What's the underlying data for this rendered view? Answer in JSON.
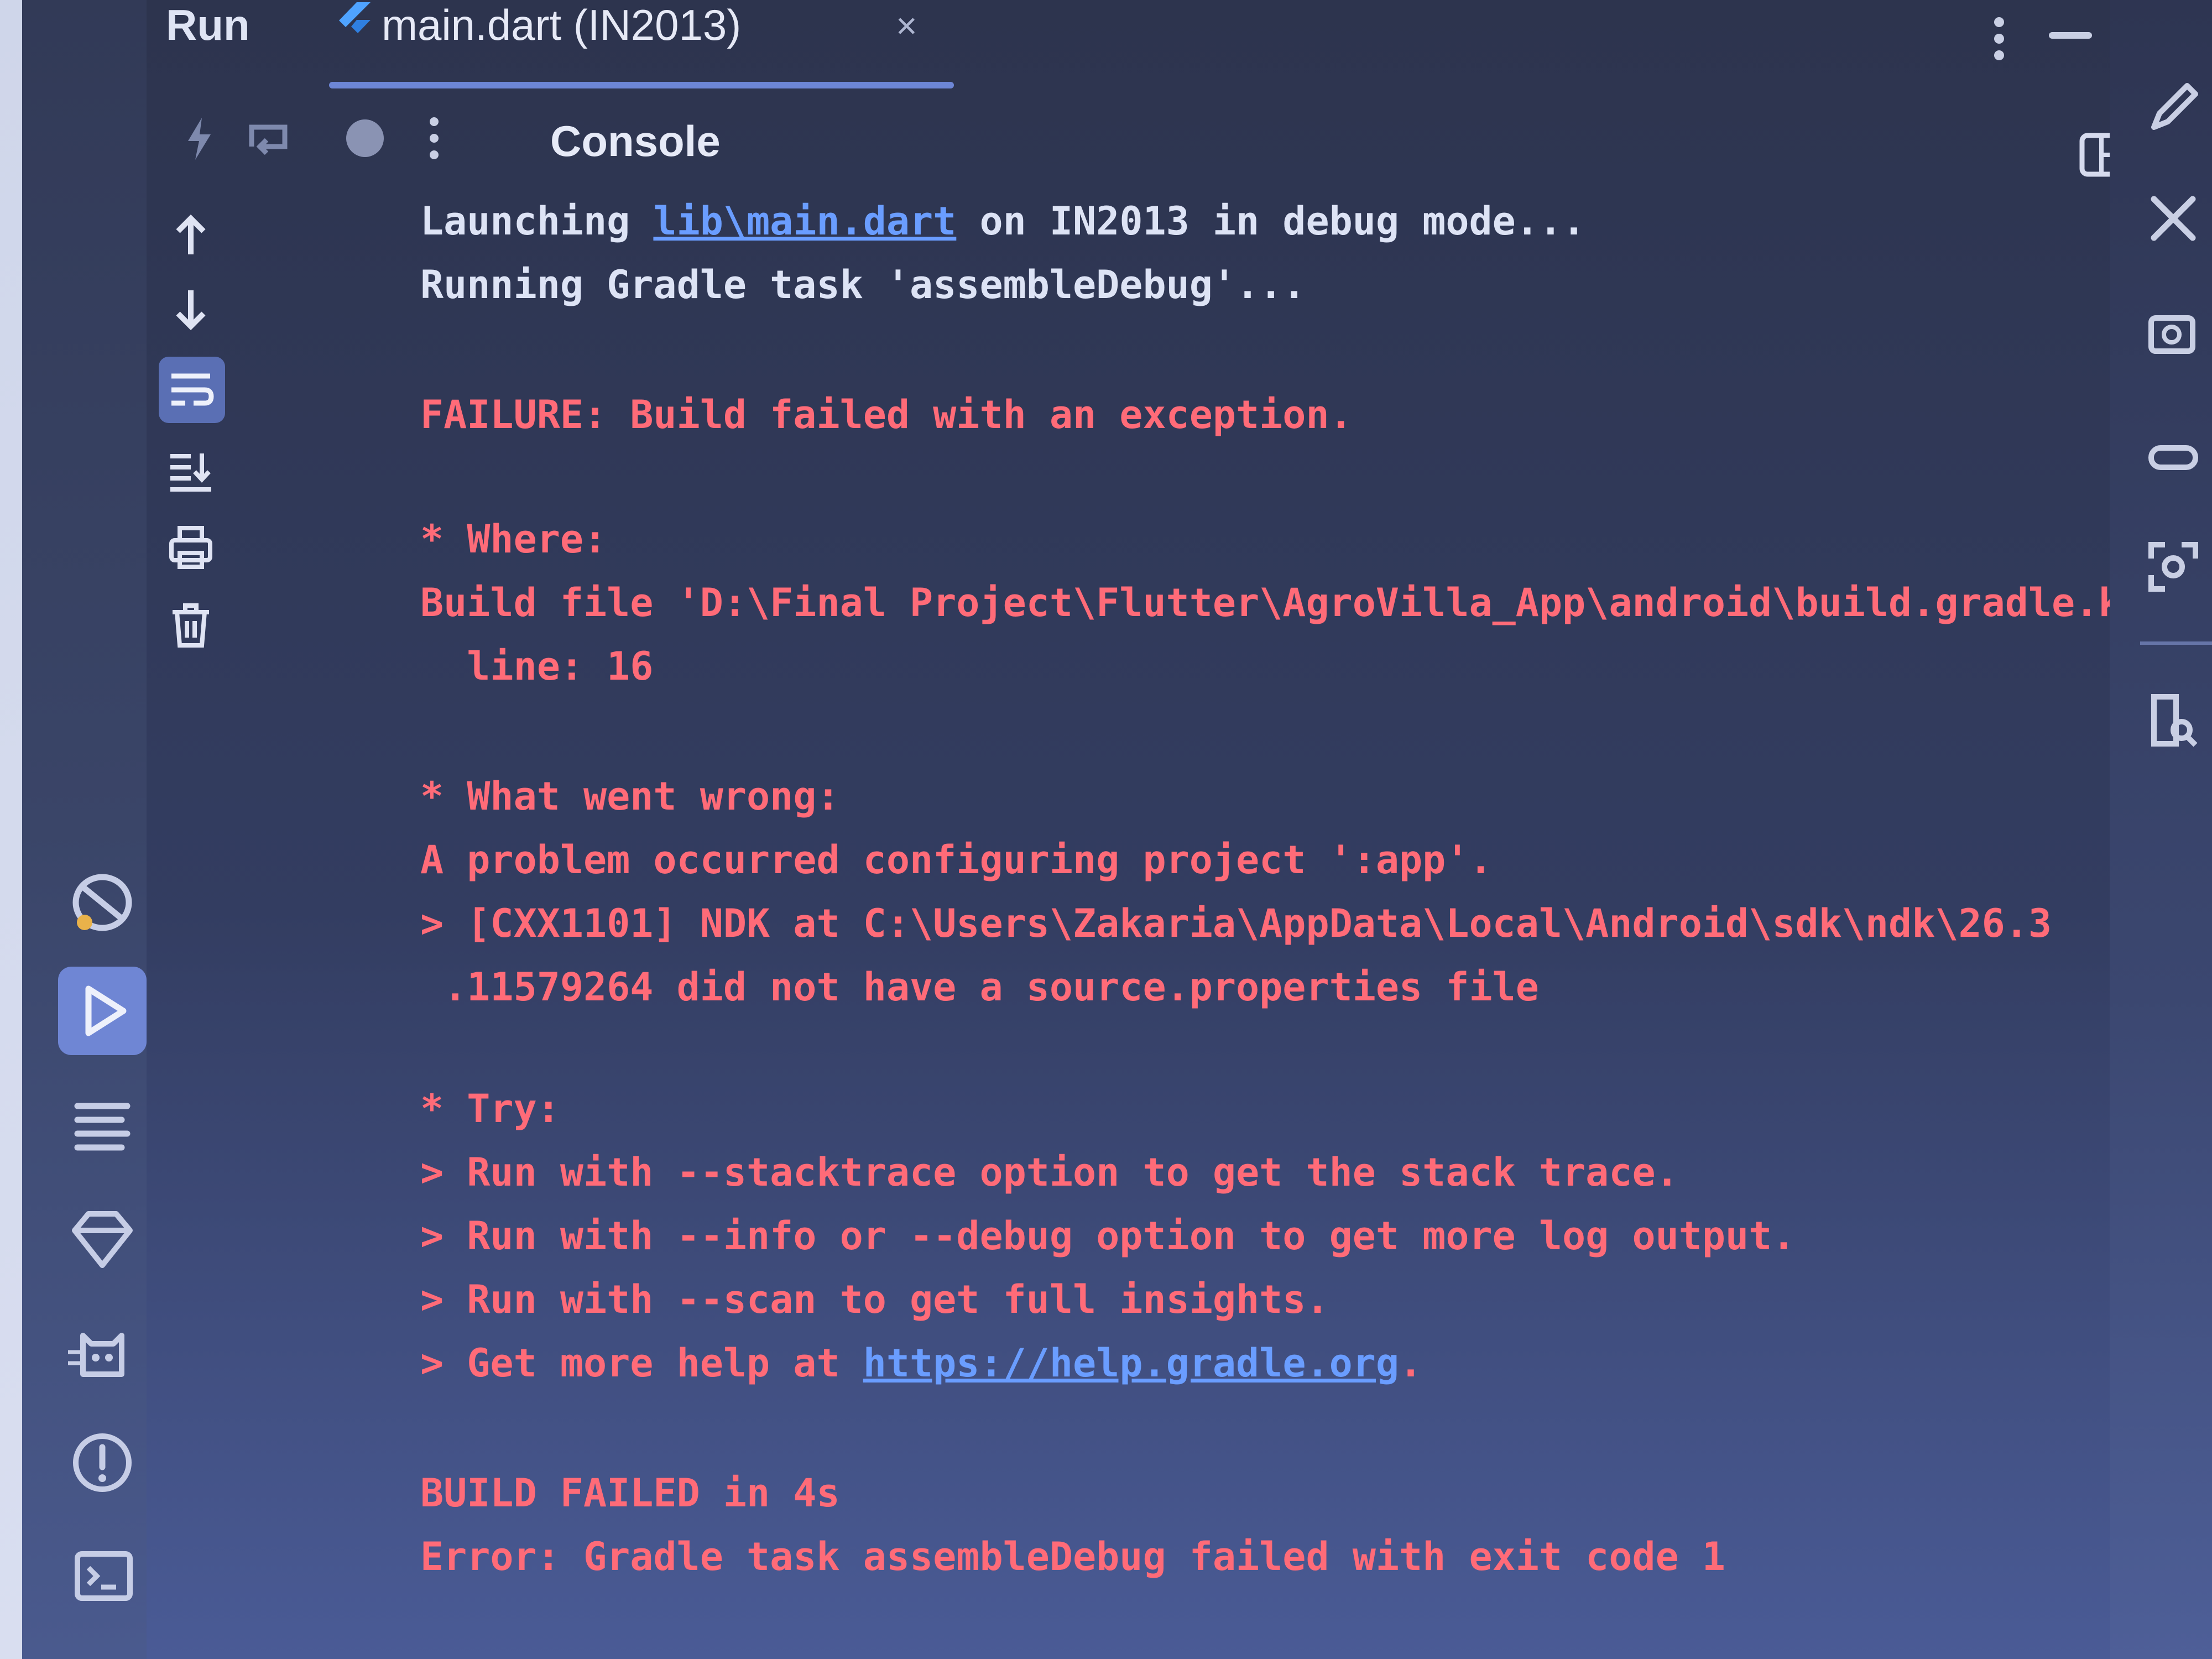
{
  "run_panel": {
    "title": "Run",
    "tab": {
      "title": "main.dart (IN2013)",
      "close": "×"
    }
  },
  "toolbar": {
    "console_label": "Console"
  },
  "console": {
    "line1": {
      "before": "Launching ",
      "link": "lib\\main.dart",
      "after": " on IN2013 in debug mode..."
    },
    "line2": "Running Gradle task 'assembleDebug'...",
    "line3": "FAILURE: Build failed with an exception.",
    "line4": "* Where:",
    "line5": "Build file 'D:\\Final Project\\Flutter\\AgroVilla_App\\android\\build.gradle.kts'",
    "line6": "  line: 16",
    "line7": "* What went wrong:",
    "line8": "A problem occurred configuring project ':app'.",
    "line9": "> [CXX1101] NDK at C:\\Users\\Zakaria\\AppData\\Local\\Android\\sdk\\ndk\\26.3",
    "line10": " .11579264 did not have a source.properties file",
    "line11": "* Try:",
    "line12": "> Run with --stacktrace option to get the stack trace.",
    "line13": "> Run with --info or --debug option to get more log output.",
    "line14": "> Run with --scan to get full insights.",
    "line15": {
      "before": "> Get more help at ",
      "link": "https://help.gradle.org",
      "after": "."
    },
    "line16": "BUILD FAILED in 4s",
    "line17": "Error: Gradle task assembleDebug failed with exit code 1"
  },
  "colors": {
    "error_text": "#ff6b78",
    "normal_text": "#dde3f5",
    "link": "#6a9dff",
    "active_accent": "#6f86d4"
  },
  "icons": {
    "left_activity": [
      "debug-icon",
      "run-icon",
      "structure-icon",
      "gem-icon",
      "logcat-icon",
      "problems-icon",
      "terminal-icon"
    ],
    "run_side_toolbar": [
      "scroll-up-icon",
      "scroll-down-icon",
      "soft-wrap-icon",
      "scroll-to-end-icon",
      "print-icon",
      "trash-icon"
    ],
    "right_bar": [
      "pen-icon",
      "tools-icon",
      "device-manager-icon",
      "link-icon",
      "screen-capture-icon",
      "file-search-icon"
    ]
  }
}
